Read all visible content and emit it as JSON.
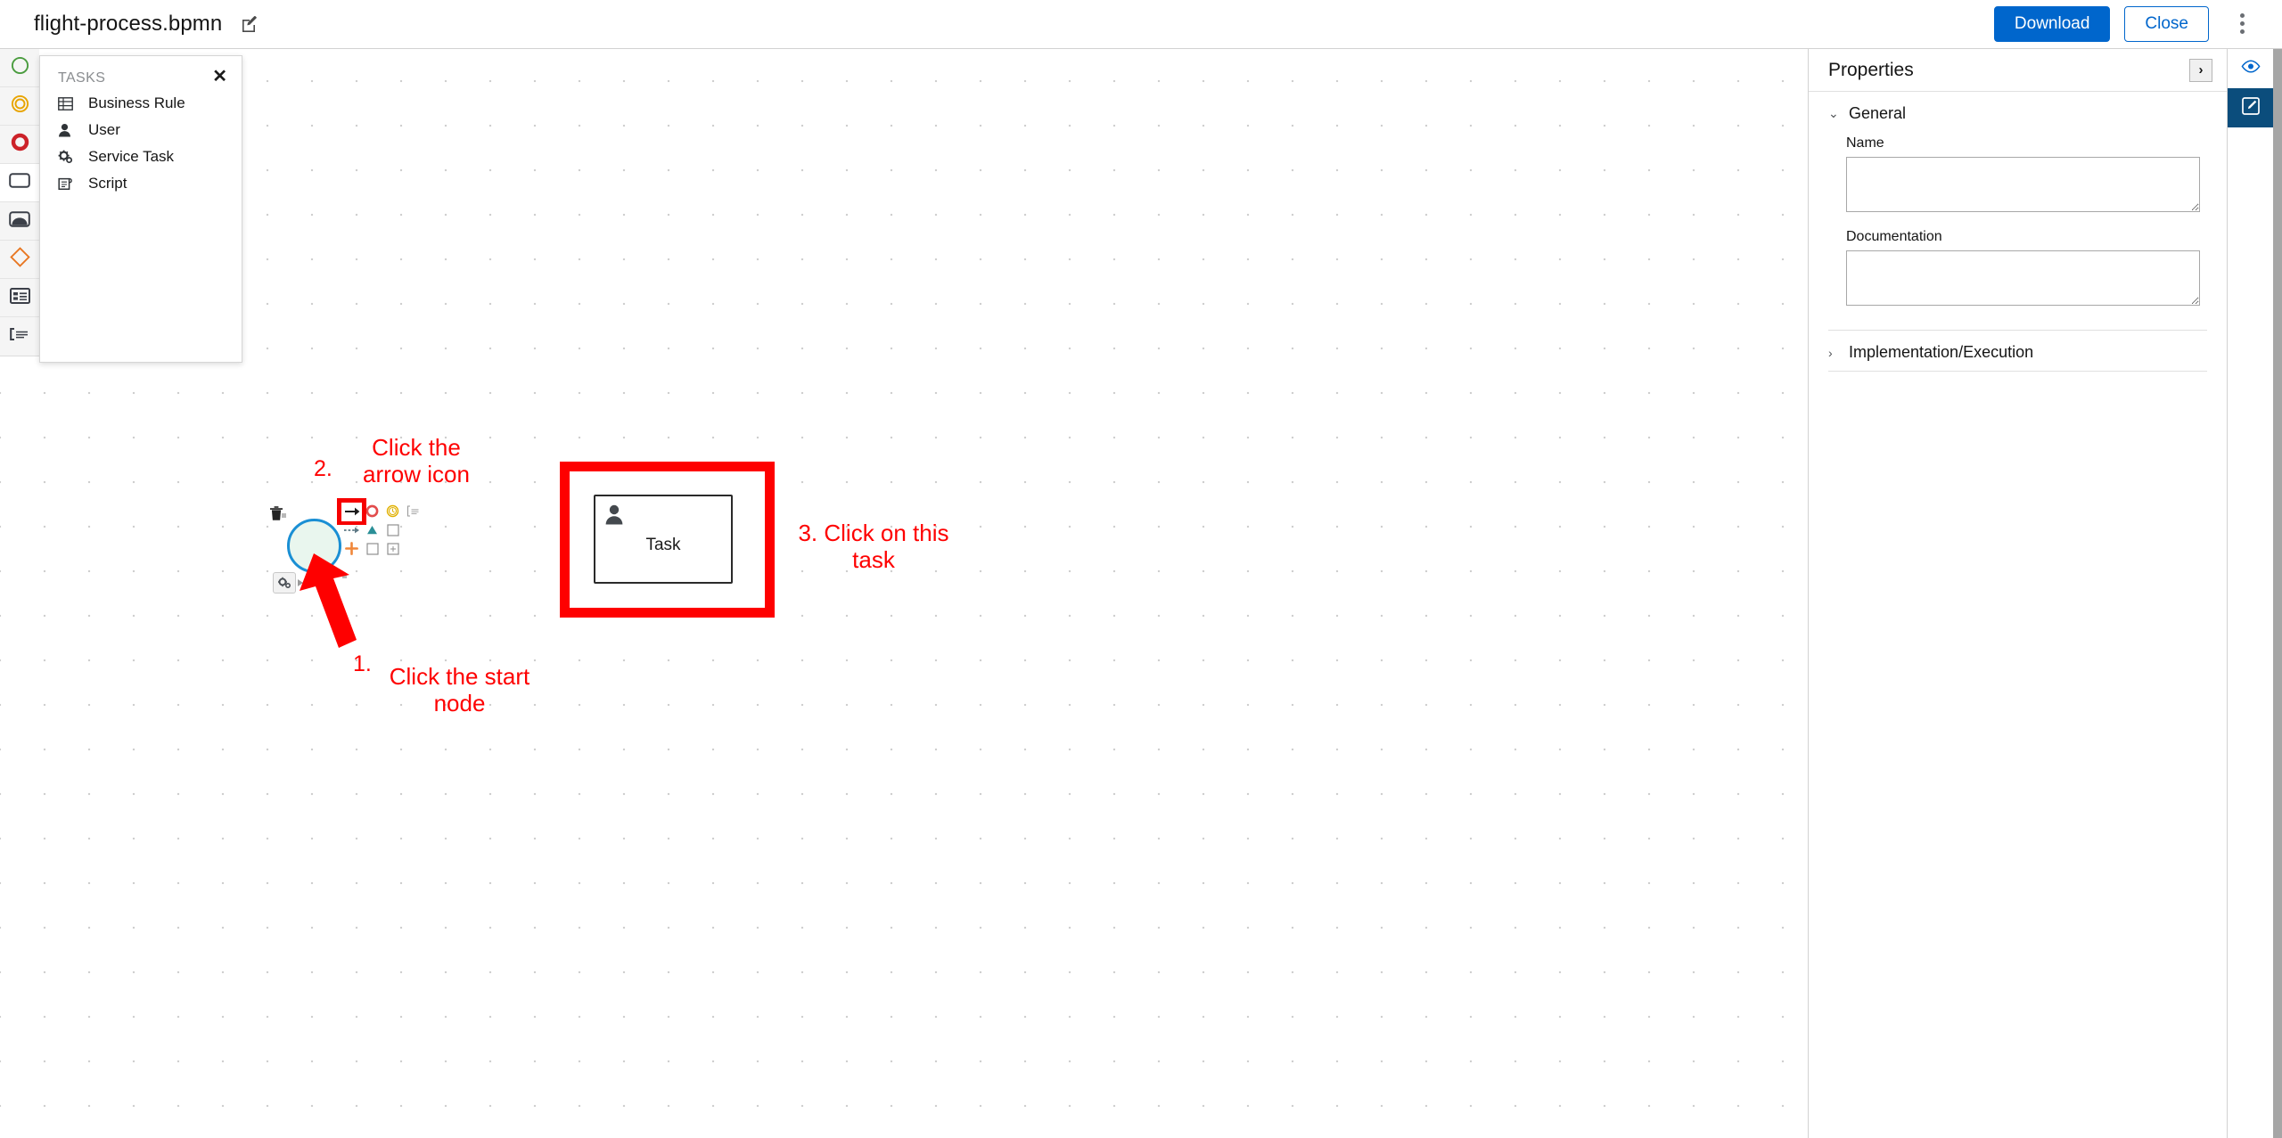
{
  "topbar": {
    "file_name": "flight-process.bpmn",
    "rename_icon": "edit-pencil-icon",
    "download_label": "Download",
    "close_label": "Close",
    "kebab_icon": "vertical-dots-icon"
  },
  "palette": {
    "items": [
      {
        "name": "start-event",
        "icon": "circle-green-icon",
        "color": "#4a9c3f"
      },
      {
        "name": "intermediate-event",
        "icon": "double-circle-orange-icon",
        "color": "#e8a400"
      },
      {
        "name": "end-event",
        "icon": "thick-circle-red-icon",
        "color": "#cc2229"
      },
      {
        "name": "task",
        "icon": "rounded-rectangle-icon",
        "color": "#3c4049"
      },
      {
        "name": "subprocess",
        "icon": "subprocess-icon",
        "color": "#3c4049"
      },
      {
        "name": "gateway",
        "icon": "diamond-orange-icon",
        "color": "#e87722"
      },
      {
        "name": "data-object",
        "icon": "table-list-icon",
        "color": "#3c4049"
      },
      {
        "name": "text-annotation",
        "icon": "annotation-bracket-icon",
        "color": "#3c4049"
      }
    ]
  },
  "tasks_popup": {
    "title": "TASKS",
    "close_icon": "close-x-icon",
    "items": [
      {
        "label": "Business Rule",
        "icon": "business-rule-table-icon"
      },
      {
        "label": "User",
        "icon": "user-person-icon"
      },
      {
        "label": "Service Task",
        "icon": "gear-cog-icon"
      },
      {
        "label": "Script",
        "icon": "script-document-icon"
      }
    ]
  },
  "canvas": {
    "start_node": {
      "name": "start-event-node",
      "stroke": "#1a8fd4",
      "fill": "#e9f6ee"
    },
    "task_node": {
      "label": "Task",
      "icon": "user-person-icon",
      "highlight_color": "#fe0000"
    },
    "trash_icon": "trash-delete-icon",
    "replace_icon": "gear-replace-icon",
    "context_pad": [
      {
        "name": "append-task",
        "icon": "arrow-right-icon",
        "highlighted": true,
        "color": "#1c1c1c"
      },
      {
        "name": "append-end-event",
        "icon": "circle-red-icon",
        "color": "#e24c4c"
      },
      {
        "name": "append-intermediate-event",
        "icon": "circle-clock-yellow-icon",
        "color": "#e0b000"
      },
      {
        "name": "append-text-annotation",
        "icon": "annotation-bracket-icon",
        "color": "#9a9a9a"
      },
      {
        "name": "connect",
        "icon": "dashed-arrow-icon",
        "color": "#7a8b94"
      },
      {
        "name": "append-gateway",
        "icon": "triangle-teal-icon",
        "color": "#2d8f96"
      },
      {
        "name": "append-task-square",
        "icon": "square-outline-icon",
        "color": "#8f8f8f"
      },
      {
        "name": "blank",
        "icon": "blank-icon",
        "color": "transparent"
      },
      {
        "name": "add-plus",
        "icon": "plus-orange-icon",
        "color": "#f0873a"
      },
      {
        "name": "append-task-plain",
        "icon": "square-outline-icon",
        "color": "#8f8f8f"
      },
      {
        "name": "append-subprocess",
        "icon": "square-plus-icon",
        "color": "#8f8f8f"
      },
      {
        "name": "blank2",
        "icon": "blank-icon",
        "color": "transparent"
      }
    ]
  },
  "annotations": {
    "step1_number": "1.",
    "step1_text": "Click the start\nnode",
    "step2_number": "2.",
    "step2_text": "Click the\narrow icon",
    "step3_text": "3. Click on this\ntask",
    "color": "#fe0000"
  },
  "properties": {
    "title": "Properties",
    "collapse_icon": "chevron-right-icon",
    "general": {
      "label": "General",
      "expanded": true,
      "chevron": "chevron-down-icon",
      "name_label": "Name",
      "name_value": "",
      "documentation_label": "Documentation",
      "documentation_value": ""
    },
    "implementation": {
      "label": "Implementation/Execution",
      "expanded": false,
      "chevron": "chevron-right-icon"
    }
  },
  "tabstrip": {
    "tabs": [
      {
        "name": "preview-tab",
        "icon": "eye-icon",
        "active": false
      },
      {
        "name": "edit-tab",
        "icon": "edit-pencil-square-icon",
        "active": true
      }
    ]
  }
}
